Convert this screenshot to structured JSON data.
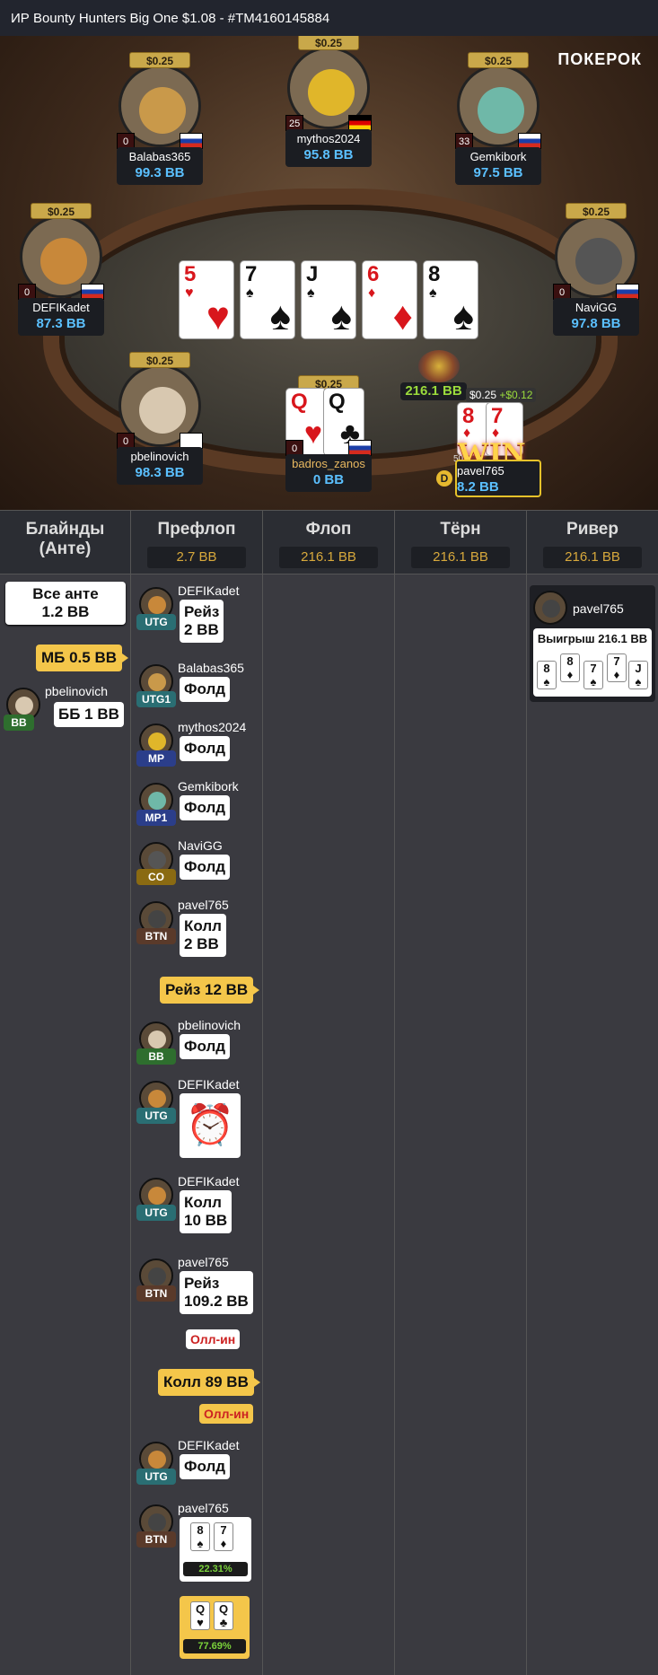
{
  "title": "ИР  Bounty Hunters Big One $1.08   - #TM4160145884",
  "logo": "ПОКЕРОК",
  "seats": [
    {
      "bounty": "$0.25",
      "count": "0",
      "name": "Balabas365",
      "stack": "99.3 BB",
      "flag": "ru",
      "avatar_color": "#c9994a"
    },
    {
      "bounty": "$0.25",
      "count": "25",
      "name": "mythos2024",
      "stack": "95.8 BB",
      "flag": "de",
      "avatar_color": "#e0b62a"
    },
    {
      "bounty": "$0.25",
      "count": "33",
      "name": "Gemkibork",
      "stack": "97.5 BB",
      "flag": "ru",
      "avatar_color": "#6fb8a8"
    },
    {
      "bounty": "$0.25",
      "count": "0",
      "name": "DEFIKadet",
      "stack": "87.3 BB",
      "flag": "ru",
      "avatar_color": "#c8883a"
    },
    {
      "bounty": "$0.25",
      "count": "0",
      "name": "NaviGG",
      "stack": "97.8 BB",
      "flag": "ru",
      "avatar_color": "#555"
    },
    {
      "bounty": "$0.25",
      "count": "0",
      "name": "pbelinovich",
      "stack": "98.3 BB",
      "flag": "cy",
      "avatar_color": "#d8c8b0"
    },
    {
      "bounty": "$0.25",
      "count": "0",
      "name": "badros_zanos",
      "stack": "0 BB",
      "flag": "ru",
      "avatar_color": "#666"
    },
    {
      "bounty": "",
      "count": "",
      "name": "pavel765",
      "stack": "8.2 BB",
      "flag": "",
      "avatar_color": "#444"
    }
  ],
  "board": [
    {
      "rank": "5",
      "suit": "♥",
      "color": "red"
    },
    {
      "rank": "7",
      "suit": "♠",
      "color": "blk"
    },
    {
      "rank": "J",
      "suit": "♠",
      "color": "blk"
    },
    {
      "rank": "6",
      "suit": "♦",
      "color": "red"
    },
    {
      "rank": "8",
      "suit": "♠",
      "color": "blk"
    }
  ],
  "pot": "216.1 BB",
  "badros_cards": [
    {
      "rank": "Q",
      "suit": "♥",
      "color": "red"
    },
    {
      "rank": "Q",
      "suit": "♣",
      "color": "blk"
    }
  ],
  "winner": {
    "bounty": "$0.25",
    "bonus": "+$0.12",
    "text": "WIN",
    "small": "50",
    "cards": [
      {
        "rank": "8",
        "suit": "♦"
      },
      {
        "rank": "7",
        "suit": "♦"
      }
    ],
    "dealer": "D"
  },
  "columns": [
    {
      "label": "Блайнды (Анте)",
      "amount": ""
    },
    {
      "label": "Префлоп",
      "amount": "2.7 BB"
    },
    {
      "label": "Флоп",
      "amount": "216.1 BB"
    },
    {
      "label": "Тёрн",
      "amount": "216.1 BB"
    },
    {
      "label": "Ривер",
      "amount": "216.1 BB"
    }
  ],
  "blinds": {
    "ante": "Все анте\n1.2 BB",
    "sb": "МБ 0.5 BB",
    "bb_name": "pbelinovich",
    "bb_pos": "BB",
    "bb_action": "ББ 1 BB"
  },
  "preflop": [
    {
      "name": "DEFIKadet",
      "pos": "UTG",
      "action": "Рейз\n2 BB"
    },
    {
      "name": "Balabas365",
      "pos": "UTG1",
      "action": "Фолд"
    },
    {
      "name": "mythos2024",
      "pos": "MP",
      "action": "Фолд"
    },
    {
      "name": "Gemkibork",
      "pos": "MP1",
      "action": "Фолд"
    },
    {
      "name": "NaviGG",
      "pos": "CO",
      "action": "Фолд"
    },
    {
      "name": "pavel765",
      "pos": "BTN",
      "action": "Колл\n2 BB"
    },
    {
      "name": "pbelinovich",
      "pos": "BB",
      "action": "Фолд"
    },
    {
      "name": "DEFIKadet",
      "pos": "UTG",
      "action": ""
    },
    {
      "name": "DEFIKadet",
      "pos": "UTG",
      "action": "Колл\n10 BB"
    },
    {
      "name": "pavel765",
      "pos": "BTN",
      "action": "Рейз\n109.2 BB"
    },
    {
      "name": "DEFIKadet",
      "pos": "UTG",
      "action": "Фолд"
    },
    {
      "name": "pavel765",
      "pos": "BTN",
      "action": ""
    }
  ],
  "hero_raise": "Рейз 12 BB",
  "hero_call": "Колл 89 BB",
  "allin": "Олл-ин",
  "pavel_show": {
    "cards": [
      {
        "rank": "8",
        "suit": "♠",
        "color": "blk"
      },
      {
        "rank": "7",
        "suit": "♦",
        "color": "red"
      }
    ],
    "equity": "22.31%"
  },
  "hero_show": {
    "cards": [
      {
        "rank": "Q",
        "suit": "♥",
        "color": "red"
      },
      {
        "rank": "Q",
        "suit": "♣",
        "color": "blk"
      }
    ],
    "equity": "77.69%"
  },
  "river": {
    "name": "pavel765",
    "result": "Выигрыш 216.1 BB",
    "cards": [
      {
        "rank": "8",
        "suit": "♠",
        "color": "blk"
      },
      {
        "rank": "8",
        "suit": "♦",
        "color": "red"
      },
      {
        "rank": "7",
        "suit": "♠",
        "color": "blk"
      },
      {
        "rank": "7",
        "suit": "♦",
        "color": "red"
      },
      {
        "rank": "J",
        "suit": "♠",
        "color": "blk"
      }
    ]
  },
  "pos_colors": {
    "UTG": "#2a6e73",
    "UTG1": "#2a6e73",
    "MP": "#2b3e8a",
    "MP1": "#2b3e8a",
    "CO": "#8a6a12",
    "BTN": "#5a3a2a",
    "BB": "#2e6e2e"
  }
}
